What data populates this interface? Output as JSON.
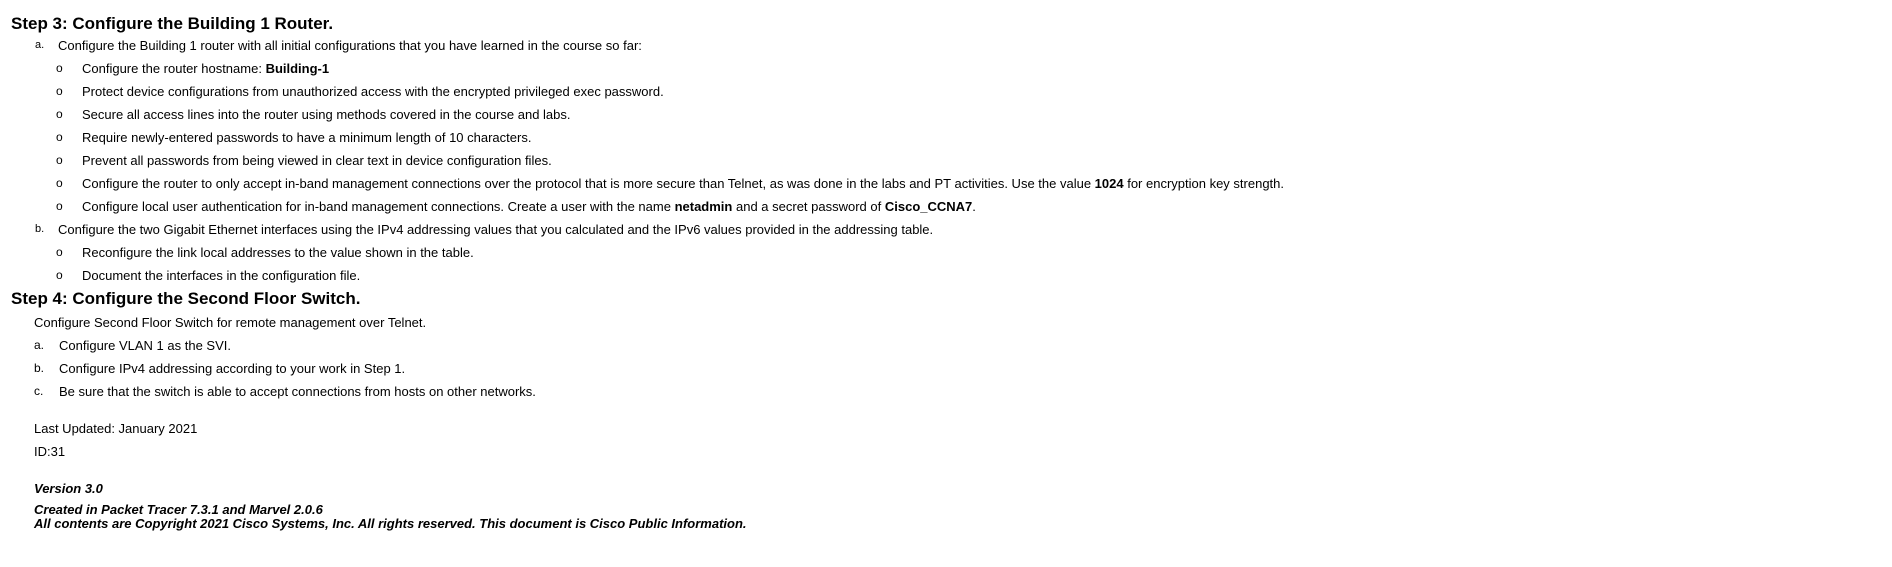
{
  "step3": {
    "heading": "Step 3: Configure the Building 1 Router.",
    "item_a": {
      "marker": "a.",
      "text": "Configure the Building 1 router with all initial configurations that you have learned in the course so far:",
      "bullets": [
        {
          "pre": "Configure the router hostname: ",
          "bold": "Building-1",
          "post": "",
          "bold2": "",
          "post2": ""
        },
        {
          "pre": "Protect device configurations from unauthorized access with the encrypted privileged exec password.",
          "bold": "",
          "post": "",
          "bold2": "",
          "post2": ""
        },
        {
          "pre": "Secure all access lines into the router using methods covered in the course and labs.",
          "bold": "",
          "post": "",
          "bold2": "",
          "post2": ""
        },
        {
          "pre": "Require newly-entered passwords to have a minimum length of 10 characters.",
          "bold": "",
          "post": "",
          "bold2": "",
          "post2": ""
        },
        {
          "pre": "Prevent all passwords from being viewed in clear text in device configuration files.",
          "bold": "",
          "post": "",
          "bold2": "",
          "post2": ""
        },
        {
          "pre": "Configure the router to only accept in-band management connections over the protocol that is more secure than Telnet, as was done in the labs and PT activities. Use the value ",
          "bold": "1024",
          "post": " for encryption key strength.",
          "bold2": "",
          "post2": ""
        },
        {
          "pre": "Configure local user authentication for in-band management connections. Create a user with the name ",
          "bold": "netadmin",
          "post": " and a secret password of ",
          "bold2": "Cisco_CCNA7",
          "post2": "."
        }
      ]
    },
    "item_b": {
      "marker": "b.",
      "text": "Configure the two Gigabit Ethernet interfaces using the IPv4 addressing values that you calculated and the IPv6 values provided in the addressing table.",
      "bullets": [
        {
          "pre": "Reconfigure the link local addresses to the value shown in the table.",
          "bold": "",
          "post": "",
          "bold2": "",
          "post2": ""
        },
        {
          "pre": "Document the interfaces in the configuration file.",
          "bold": "",
          "post": "",
          "bold2": "",
          "post2": ""
        }
      ]
    },
    "bullet_marker": "o"
  },
  "step4": {
    "heading": "Step 4: Configure the Second Floor Switch.",
    "intro": "Configure Second Floor Switch for remote management over Telnet.",
    "items": [
      {
        "marker": "a.",
        "text": "Configure VLAN 1 as the SVI."
      },
      {
        "marker": "b.",
        "text": "Configure IPv4 addressing according to your work in Step 1."
      },
      {
        "marker": "c.",
        "text": "Be sure that the switch is able to accept connections from hosts on other networks."
      }
    ]
  },
  "footer": {
    "last_updated": "Last Updated: January 2021",
    "id": "ID:31",
    "version": "Version 3.0",
    "created": "Created in Packet Tracer 7.3.1 and Marvel 2.0.6",
    "copyright": "All contents are Copyright 2021 Cisco Systems, Inc. All rights reserved. This document is Cisco Public Information."
  }
}
